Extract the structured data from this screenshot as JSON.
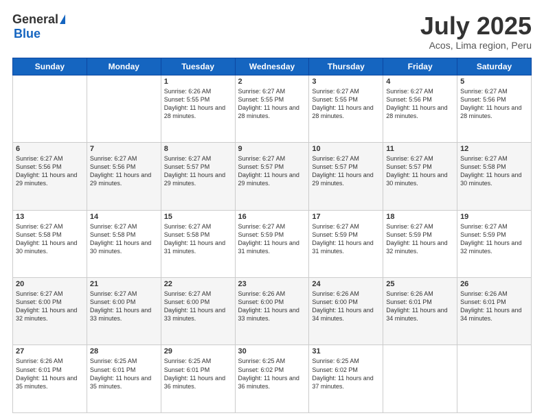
{
  "logo": {
    "general": "General",
    "blue": "Blue"
  },
  "header": {
    "month": "July 2025",
    "location": "Acos, Lima region, Peru"
  },
  "weekdays": [
    "Sunday",
    "Monday",
    "Tuesday",
    "Wednesday",
    "Thursday",
    "Friday",
    "Saturday"
  ],
  "weeks": [
    [
      {
        "day": "",
        "sunrise": "",
        "sunset": "",
        "daylight": ""
      },
      {
        "day": "",
        "sunrise": "",
        "sunset": "",
        "daylight": ""
      },
      {
        "day": "1",
        "sunrise": "Sunrise: 6:26 AM",
        "sunset": "Sunset: 5:55 PM",
        "daylight": "Daylight: 11 hours and 28 minutes."
      },
      {
        "day": "2",
        "sunrise": "Sunrise: 6:27 AM",
        "sunset": "Sunset: 5:55 PM",
        "daylight": "Daylight: 11 hours and 28 minutes."
      },
      {
        "day": "3",
        "sunrise": "Sunrise: 6:27 AM",
        "sunset": "Sunset: 5:55 PM",
        "daylight": "Daylight: 11 hours and 28 minutes."
      },
      {
        "day": "4",
        "sunrise": "Sunrise: 6:27 AM",
        "sunset": "Sunset: 5:56 PM",
        "daylight": "Daylight: 11 hours and 28 minutes."
      },
      {
        "day": "5",
        "sunrise": "Sunrise: 6:27 AM",
        "sunset": "Sunset: 5:56 PM",
        "daylight": "Daylight: 11 hours and 28 minutes."
      }
    ],
    [
      {
        "day": "6",
        "sunrise": "Sunrise: 6:27 AM",
        "sunset": "Sunset: 5:56 PM",
        "daylight": "Daylight: 11 hours and 29 minutes."
      },
      {
        "day": "7",
        "sunrise": "Sunrise: 6:27 AM",
        "sunset": "Sunset: 5:56 PM",
        "daylight": "Daylight: 11 hours and 29 minutes."
      },
      {
        "day": "8",
        "sunrise": "Sunrise: 6:27 AM",
        "sunset": "Sunset: 5:57 PM",
        "daylight": "Daylight: 11 hours and 29 minutes."
      },
      {
        "day": "9",
        "sunrise": "Sunrise: 6:27 AM",
        "sunset": "Sunset: 5:57 PM",
        "daylight": "Daylight: 11 hours and 29 minutes."
      },
      {
        "day": "10",
        "sunrise": "Sunrise: 6:27 AM",
        "sunset": "Sunset: 5:57 PM",
        "daylight": "Daylight: 11 hours and 29 minutes."
      },
      {
        "day": "11",
        "sunrise": "Sunrise: 6:27 AM",
        "sunset": "Sunset: 5:57 PM",
        "daylight": "Daylight: 11 hours and 30 minutes."
      },
      {
        "day": "12",
        "sunrise": "Sunrise: 6:27 AM",
        "sunset": "Sunset: 5:58 PM",
        "daylight": "Daylight: 11 hours and 30 minutes."
      }
    ],
    [
      {
        "day": "13",
        "sunrise": "Sunrise: 6:27 AM",
        "sunset": "Sunset: 5:58 PM",
        "daylight": "Daylight: 11 hours and 30 minutes."
      },
      {
        "day": "14",
        "sunrise": "Sunrise: 6:27 AM",
        "sunset": "Sunset: 5:58 PM",
        "daylight": "Daylight: 11 hours and 30 minutes."
      },
      {
        "day": "15",
        "sunrise": "Sunrise: 6:27 AM",
        "sunset": "Sunset: 5:58 PM",
        "daylight": "Daylight: 11 hours and 31 minutes."
      },
      {
        "day": "16",
        "sunrise": "Sunrise: 6:27 AM",
        "sunset": "Sunset: 5:59 PM",
        "daylight": "Daylight: 11 hours and 31 minutes."
      },
      {
        "day": "17",
        "sunrise": "Sunrise: 6:27 AM",
        "sunset": "Sunset: 5:59 PM",
        "daylight": "Daylight: 11 hours and 31 minutes."
      },
      {
        "day": "18",
        "sunrise": "Sunrise: 6:27 AM",
        "sunset": "Sunset: 5:59 PM",
        "daylight": "Daylight: 11 hours and 32 minutes."
      },
      {
        "day": "19",
        "sunrise": "Sunrise: 6:27 AM",
        "sunset": "Sunset: 5:59 PM",
        "daylight": "Daylight: 11 hours and 32 minutes."
      }
    ],
    [
      {
        "day": "20",
        "sunrise": "Sunrise: 6:27 AM",
        "sunset": "Sunset: 6:00 PM",
        "daylight": "Daylight: 11 hours and 32 minutes."
      },
      {
        "day": "21",
        "sunrise": "Sunrise: 6:27 AM",
        "sunset": "Sunset: 6:00 PM",
        "daylight": "Daylight: 11 hours and 33 minutes."
      },
      {
        "day": "22",
        "sunrise": "Sunrise: 6:27 AM",
        "sunset": "Sunset: 6:00 PM",
        "daylight": "Daylight: 11 hours and 33 minutes."
      },
      {
        "day": "23",
        "sunrise": "Sunrise: 6:26 AM",
        "sunset": "Sunset: 6:00 PM",
        "daylight": "Daylight: 11 hours and 33 minutes."
      },
      {
        "day": "24",
        "sunrise": "Sunrise: 6:26 AM",
        "sunset": "Sunset: 6:00 PM",
        "daylight": "Daylight: 11 hours and 34 minutes."
      },
      {
        "day": "25",
        "sunrise": "Sunrise: 6:26 AM",
        "sunset": "Sunset: 6:01 PM",
        "daylight": "Daylight: 11 hours and 34 minutes."
      },
      {
        "day": "26",
        "sunrise": "Sunrise: 6:26 AM",
        "sunset": "Sunset: 6:01 PM",
        "daylight": "Daylight: 11 hours and 34 minutes."
      }
    ],
    [
      {
        "day": "27",
        "sunrise": "Sunrise: 6:26 AM",
        "sunset": "Sunset: 6:01 PM",
        "daylight": "Daylight: 11 hours and 35 minutes."
      },
      {
        "day": "28",
        "sunrise": "Sunrise: 6:25 AM",
        "sunset": "Sunset: 6:01 PM",
        "daylight": "Daylight: 11 hours and 35 minutes."
      },
      {
        "day": "29",
        "sunrise": "Sunrise: 6:25 AM",
        "sunset": "Sunset: 6:01 PM",
        "daylight": "Daylight: 11 hours and 36 minutes."
      },
      {
        "day": "30",
        "sunrise": "Sunrise: 6:25 AM",
        "sunset": "Sunset: 6:02 PM",
        "daylight": "Daylight: 11 hours and 36 minutes."
      },
      {
        "day": "31",
        "sunrise": "Sunrise: 6:25 AM",
        "sunset": "Sunset: 6:02 PM",
        "daylight": "Daylight: 11 hours and 37 minutes."
      },
      {
        "day": "",
        "sunrise": "",
        "sunset": "",
        "daylight": ""
      },
      {
        "day": "",
        "sunrise": "",
        "sunset": "",
        "daylight": ""
      }
    ]
  ]
}
